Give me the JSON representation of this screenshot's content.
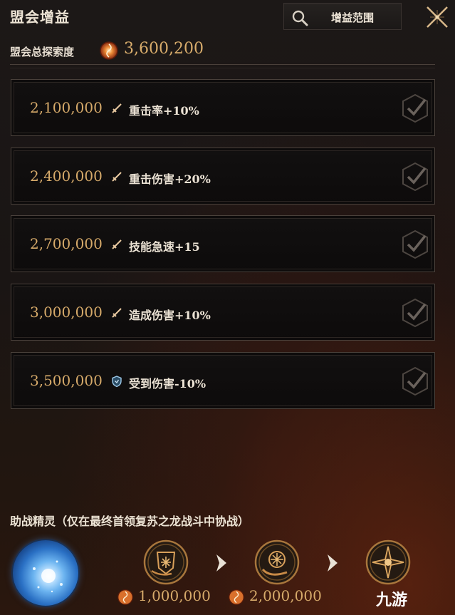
{
  "header": {
    "title": "盟会增益",
    "range_button_label": "增益范围",
    "search_icon": "search-icon",
    "close_icon": "close-icon"
  },
  "score": {
    "label": "盟会总探索度",
    "icon": "exploration-orb-icon",
    "value": "3,600,200"
  },
  "tiers": [
    {
      "amount": "2,100,000",
      "buff_icon": "sword-icon",
      "buff": "重击率+10%",
      "status": "achieved"
    },
    {
      "amount": "2,400,000",
      "buff_icon": "sword-icon",
      "buff": "重击伤害+20%",
      "status": "achieved"
    },
    {
      "amount": "2,700,000",
      "buff_icon": "sword-icon",
      "buff": "技能急速+15",
      "status": "achieved"
    },
    {
      "amount": "3,000,000",
      "buff_icon": "sword-icon",
      "buff": "造成伤害+10%",
      "status": "achieved"
    },
    {
      "amount": "3,500,000",
      "buff_icon": "shield-icon",
      "buff": "受到伤害-10%",
      "status": "achieved"
    }
  ],
  "spirit": {
    "label": "助战精灵（仅在最终首领复苏之龙战斗中协战）",
    "orb_icon": "ice-spirit-orb-icon",
    "stages": [
      {
        "icon": "spirit-stage-1-icon",
        "cost": "1,000,000"
      },
      {
        "icon": "spirit-stage-2-icon",
        "cost": "2,000,000"
      },
      {
        "icon": "spirit-stage-3-icon",
        "cost": ""
      }
    ]
  },
  "watermark": "九游",
  "colors": {
    "gold": "#d6aa6a",
    "text": "#ebe2d4",
    "panel": "#0f0d0d",
    "border": "#4a413b"
  }
}
